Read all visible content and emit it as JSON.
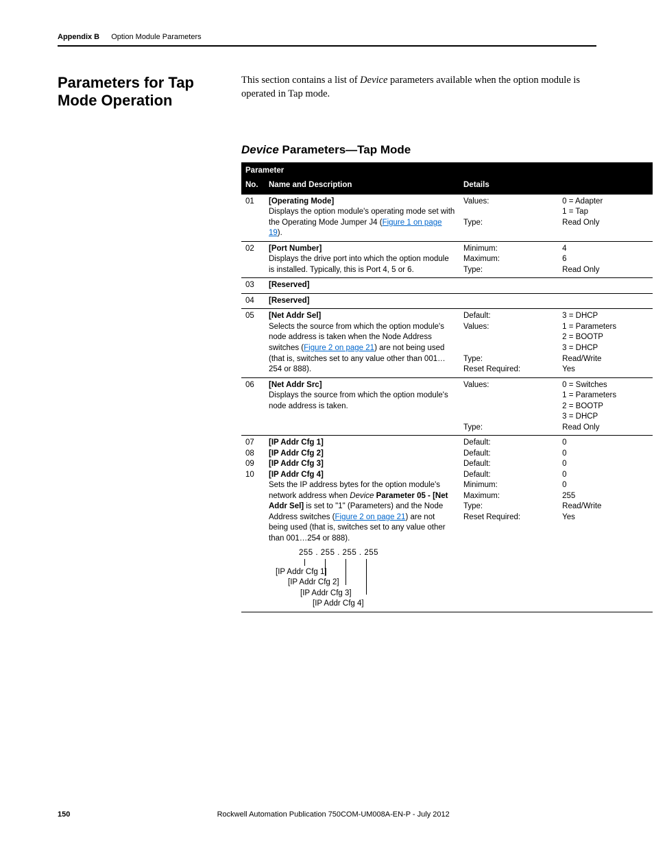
{
  "header": {
    "appendix_label": "Appendix B",
    "chapter_title": "Option Module Parameters"
  },
  "section1": {
    "heading": "Parameters for Tap Mode Operation",
    "body_pre": "This section contains a list of ",
    "body_italic": "Device",
    "body_post": " parameters available when the option module is operated in Tap mode."
  },
  "section2": {
    "heading_italic": "Device",
    "heading_rest": " Parameters—Tap Mode"
  },
  "table": {
    "header_parameter": "Parameter",
    "header_no": "No.",
    "header_name": "Name and Description",
    "header_details": "Details",
    "rows": [
      {
        "no": "01",
        "name": "[Operating Mode]",
        "desc1": "Displays the option module's operating mode set with the Operating Mode Jumper J4 (",
        "link": "Figure 1 on page 19",
        "desc2": ").",
        "details": [
          {
            "label": "Values:",
            "value": "0 = Adapter"
          },
          {
            "label": "",
            "value": "1 = Tap"
          },
          {
            "label": "Type:",
            "value": "Read Only"
          }
        ]
      },
      {
        "no": "02",
        "name": "[Port Number]",
        "desc1": "Displays the drive port into which the option module is installed. Typically, this is Port 4, 5 or 6.",
        "details": [
          {
            "label": "Minimum:",
            "value": "4"
          },
          {
            "label": "Maximum:",
            "value": "6"
          },
          {
            "label": "Type:",
            "value": "Read Only"
          }
        ]
      },
      {
        "no": "03",
        "name": "[Reserved]",
        "details": []
      },
      {
        "no": "04",
        "name": "[Reserved]",
        "details": []
      },
      {
        "no": "05",
        "name": "[Net Addr Sel]",
        "desc1": "Selects the source from which the option module's node address is taken when the Node Address switches (",
        "link": "Figure 2 on page 21",
        "desc2": ") are not being used (that is, switches set to any value other than 001…254 or 888).",
        "details": [
          {
            "label": "Default:",
            "value": "3 = DHCP"
          },
          {
            "label": "Values:",
            "value": "1 = Parameters"
          },
          {
            "label": "",
            "value": "2 = BOOTP"
          },
          {
            "label": "",
            "value": "3 = DHCP"
          },
          {
            "label": "Type:",
            "value": "Read/Write"
          },
          {
            "label": "Reset Required:",
            "value": "Yes"
          }
        ]
      },
      {
        "no": "06",
        "name": "[Net Addr Src]",
        "desc1": "Displays the source from which the option module's node address is taken.",
        "details": [
          {
            "label": "Values:",
            "value": "0 = Switches"
          },
          {
            "label": "",
            "value": "1 = Parameters"
          },
          {
            "label": "",
            "value": "2 = BOOTP"
          },
          {
            "label": "",
            "value": "3 = DHCP"
          },
          {
            "label": "Type:",
            "value": "Read Only"
          }
        ]
      },
      {
        "no_lines": [
          "07",
          "08",
          "09",
          "10"
        ],
        "names": [
          "[IP Addr Cfg 1]",
          "[IP Addr Cfg 2]",
          "[IP Addr Cfg 3]",
          "[IP Addr Cfg 4]"
        ],
        "desc_pre1": "Sets the IP address bytes for the option module's network address when ",
        "desc_italic": "Device",
        "desc_bold": " Parameter 05 - [Net Addr Sel]",
        "desc_pre2": " is set to \"1\" (Parameters) and the Node Address switches (",
        "link": "Figure 2 on page 21",
        "desc_post": ") are not being used (that is, switches set to any value other than 001…254 or 888).",
        "ip_example": "255 . 255 . 255 . 255",
        "ip_labels": [
          "[IP Addr Cfg 1]",
          "[IP Addr Cfg 2]",
          "[IP Addr Cfg 3]",
          "[IP Addr Cfg 4]"
        ],
        "details": [
          {
            "label": "Default:",
            "value": "0"
          },
          {
            "label": "Default:",
            "value": "0"
          },
          {
            "label": "Default:",
            "value": "0"
          },
          {
            "label": "Default:",
            "value": "0"
          },
          {
            "label": "Minimum:",
            "value": "0"
          },
          {
            "label": "Maximum:",
            "value": "255"
          },
          {
            "label": "Type:",
            "value": "Read/Write"
          },
          {
            "label": "Reset Required:",
            "value": "Yes"
          }
        ]
      }
    ]
  },
  "footer": {
    "page": "150",
    "pubid": "Rockwell Automation Publication 750COM-UM008A-EN-P - July 2012"
  }
}
